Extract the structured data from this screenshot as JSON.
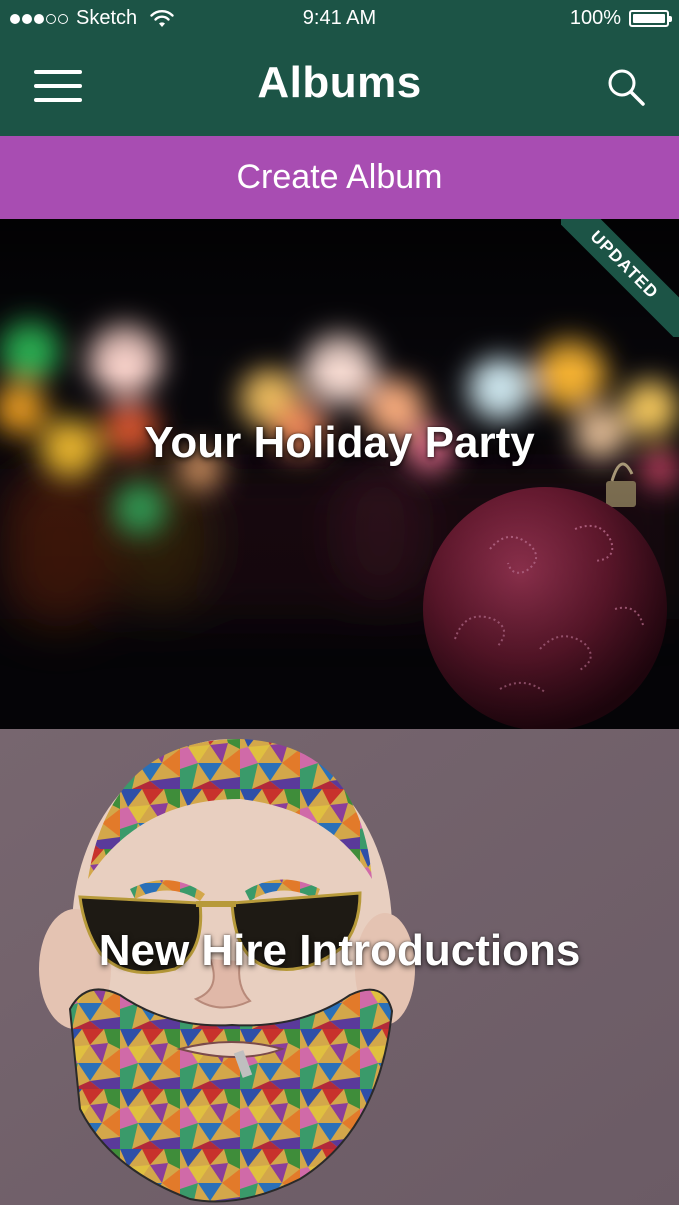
{
  "status_bar": {
    "carrier": "Sketch",
    "time": "9:41 AM",
    "battery": "100%",
    "signal_bars_filled": 3,
    "signal_bars_total": 5
  },
  "nav": {
    "title": "Albums",
    "menu_icon": "hamburger-menu-icon",
    "search_icon": "search-icon"
  },
  "create_album_label": "Create Album",
  "albums": [
    {
      "title": "Your Holiday Party",
      "badge": "UPDATED"
    },
    {
      "title": "New Hire Introductions"
    }
  ],
  "colors": {
    "primary": "#1c5446",
    "accent": "#a84db2"
  }
}
